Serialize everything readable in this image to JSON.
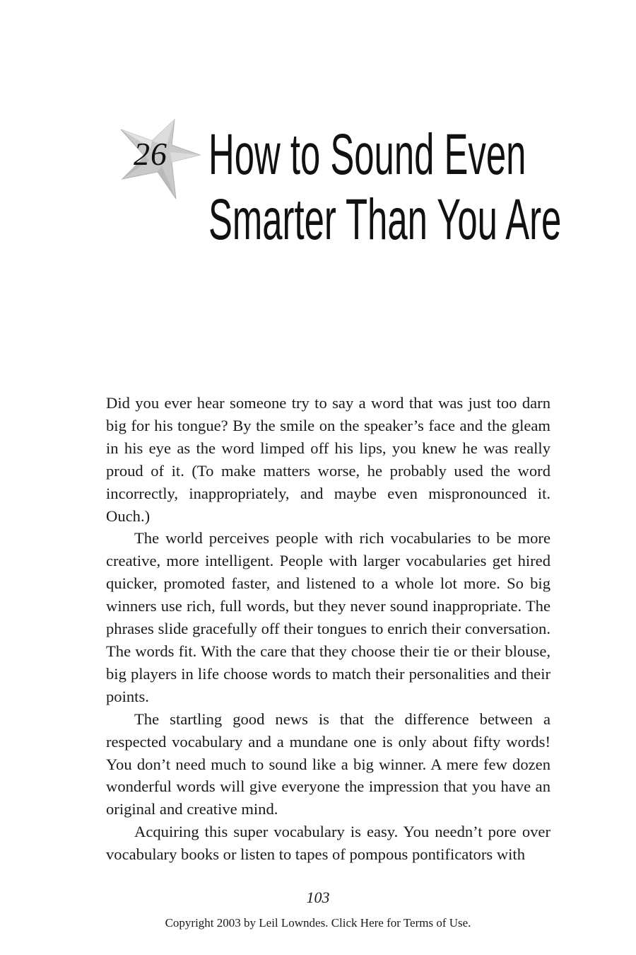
{
  "chapter": {
    "number": "26",
    "title_line1": "How to Sound Even",
    "title_line2": "Smarter Than You Are",
    "icon": "star-icon"
  },
  "paragraphs": [
    "Did you ever hear someone try to say a word that was just too darn big for his tongue? By the smile on the speaker’s face and the gleam in his eye as the word limped off his lips, you knew he was really proud of it. (To make matters worse, he probably used the word incorrectly, inappropriately, and maybe even mispronounced it. Ouch.)",
    "The world perceives people with rich vocabularies to be more creative, more intelligent. People with larger vocabularies get hired quicker, promoted faster, and listened to a whole lot more. So big winners use rich, full words, but they never sound inappropriate. The phrases slide gracefully off their tongues to enrich their con­versation. The words fit. With the care that they choose their tie or their blouse, big players in life choose words to match their per­sonalities and their points.",
    "The startling good news is that the difference between a respected vocabulary and a mundane one is only about fifty words! You don’t need much to sound like a big winner. A mere few dozen wonderful words will give everyone the impression that you have an original and creative mind.",
    "Acquiring this super vocabulary is easy. You needn’t pore over vocabulary books or listen to tapes of pompous pontificators with"
  ],
  "page_number": "103",
  "copyright": "Copyright 2003 by Leil Lowndes. Click Here for Terms of Use."
}
